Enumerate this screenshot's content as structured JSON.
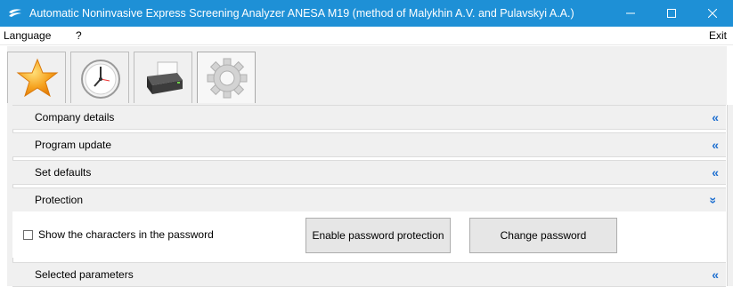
{
  "window": {
    "title": "Automatic Noninvasive Express Screening Analyzer ANESA M19 (method of Malykhin A.V. and Pulavskyi A.A.)",
    "accent": "#1e90d6",
    "controls": [
      "minimize-icon",
      "maximize-icon",
      "close-icon"
    ]
  },
  "menu": {
    "language": "Language",
    "help": "?",
    "exit": "Exit"
  },
  "toolbar": {
    "tabs": [
      {
        "icon": "star-icon"
      },
      {
        "icon": "clock-icon"
      },
      {
        "icon": "printer-icon"
      },
      {
        "icon": "gear-icon",
        "active": true
      }
    ]
  },
  "sections": [
    {
      "label": "Company details",
      "chevron": "«"
    },
    {
      "label": "Program update",
      "chevron": "«"
    },
    {
      "label": "Set defaults",
      "chevron": "«"
    },
    {
      "label": "Protection",
      "chevron": "»"
    },
    {
      "label": "Selected parameters",
      "chevron": "«"
    }
  ],
  "protection": {
    "show_password_label": "Show the characters in the password",
    "show_password_checked": false,
    "enable_button": "Enable password protection",
    "change_button": "Change password"
  }
}
